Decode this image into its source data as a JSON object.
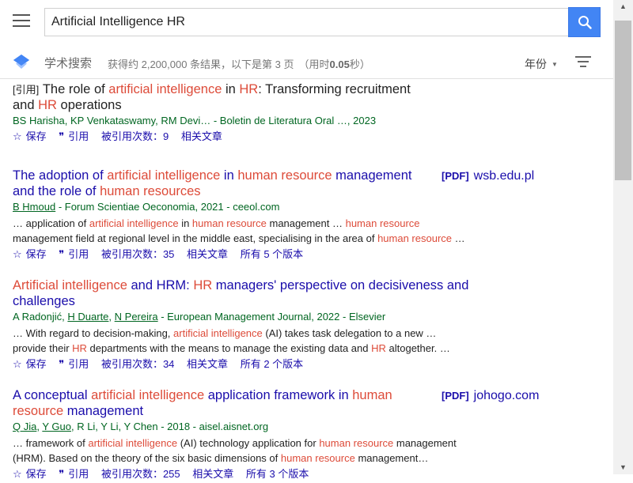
{
  "search": {
    "query": "Artificial Intelligence HR"
  },
  "subbar": {
    "brand": "学术搜索",
    "stats_text": "获得约 2,200,000 条结果，以下是第 3 页",
    "time_prefix": "（用时",
    "time_value": "0.05",
    "time_suffix": "秒）",
    "year_filter": "年份"
  },
  "actions": {
    "save": "保存",
    "cite": "引用",
    "cited_by_prefix": "被引用次数：",
    "related": "相关文章",
    "versions_prefix": "所有 ",
    "versions_suffix": " 个版本"
  },
  "results": [
    {
      "type_tag": "[引用]",
      "title_parts": [
        "The role of ",
        "artificial intelligence",
        " in ",
        "HR",
        ": Transforming recruitment and ",
        "HR",
        " operations"
      ],
      "pdf_tag": "",
      "pdf_domain": "",
      "authors": "BS Harisha, KP Venkataswamy, RM Devi… - Boletin de Literatura Oral …, 2023",
      "snippet1_parts": [],
      "snippet2_parts": [],
      "cited_by": "9",
      "versions": ""
    },
    {
      "type_tag": "",
      "title_parts": [
        "The adoption of ",
        "artificial intelligence",
        " in ",
        "human resource",
        " management and the role of ",
        "human resources",
        ""
      ],
      "pdf_tag": "[PDF]",
      "pdf_domain": "wsb.edu.pl",
      "author_link": "B Hmoud",
      "authors_rest": " - Forum Scientiae Oeconomia, 2021 - ceeol.com",
      "snippet1_parts": [
        "… application of ",
        "artificial intelligence",
        " in ",
        "human resource",
        " management … ",
        "human resource",
        ""
      ],
      "snippet2_parts": [
        "management field at regional level in the middle east, specialising in the area of ",
        "human resource",
        " …"
      ],
      "cited_by": "35",
      "versions": "5"
    },
    {
      "type_tag": "",
      "title_parts": [
        "",
        "Artificial intelligence",
        " and HRM: ",
        "HR",
        " managers' perspective on decisiveness and challenges"
      ],
      "pdf_tag": "",
      "pdf_domain": "",
      "authors_list": [
        "A Radonjić",
        ", ",
        "H Duarte",
        ", ",
        "N Pereira",
        " - European Management Journal, 2022 - Elsevier"
      ],
      "snippet1_parts": [
        "… With regard to decision-making, ",
        "artificial intelligence",
        " (AI) takes task delegation to a new …"
      ],
      "snippet2_parts": [
        "provide their ",
        "HR",
        " departments with the means to manage the existing data and ",
        "HR",
        " altogether. …"
      ],
      "cited_by": "34",
      "versions": "2"
    },
    {
      "type_tag": "",
      "title_parts": [
        "A conceptual ",
        "artificial intelligence",
        " application framework in ",
        "human resource",
        " management"
      ],
      "pdf_tag": "[PDF]",
      "pdf_domain": "johogo.com",
      "authors_list": [
        "Q Jia",
        ", ",
        "Y Guo",
        ", R Li, Y Li, Y Chen - 2018 - aisel.aisnet.org"
      ],
      "snippet1_parts": [
        "… framework of ",
        "artificial intelligence",
        " (AI) technology application for ",
        "human resource",
        " management"
      ],
      "snippet2_parts": [
        "(HRM). Based on the theory of the six basic dimensions of ",
        "human resource",
        " management…"
      ],
      "cited_by": "255",
      "versions": "3"
    }
  ],
  "icons": {
    "menu": "menu-icon",
    "search": "search-icon",
    "logo": "scholar-cap-icon",
    "sort": "sort-icon",
    "star": "star-icon",
    "quote": "quote-icon"
  },
  "colors": {
    "link": "#1a0dab",
    "highlight": "#dd4b39",
    "green": "#006621",
    "accent": "#4285f4"
  }
}
